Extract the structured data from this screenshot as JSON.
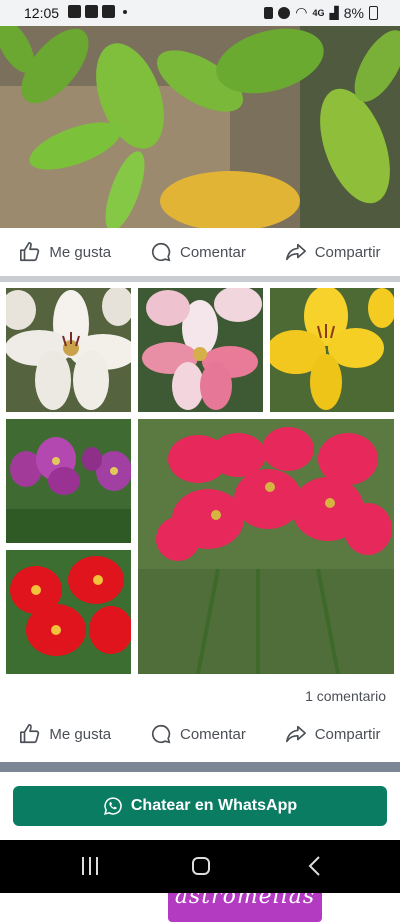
{
  "status_bar": {
    "time": "12:05",
    "network": "4G",
    "battery": "8%"
  },
  "post_one": {
    "actions": {
      "like": "Me gusta",
      "comment": "Comentar",
      "share": "Compartir"
    }
  },
  "post_two": {
    "image_label": "astromelias",
    "comment_count": "1 comentario",
    "actions": {
      "like": "Me gusta",
      "comment": "Comentar",
      "share": "Compartir"
    }
  },
  "whatsapp_button": {
    "label": "Chatear en WhatsApp",
    "color": "#0a7c62"
  },
  "icons": [
    "like-icon",
    "comment-icon",
    "share-icon",
    "gallery-grid-icon",
    "whatsapp-icon",
    "recent-apps-icon",
    "home-icon",
    "back-icon"
  ]
}
